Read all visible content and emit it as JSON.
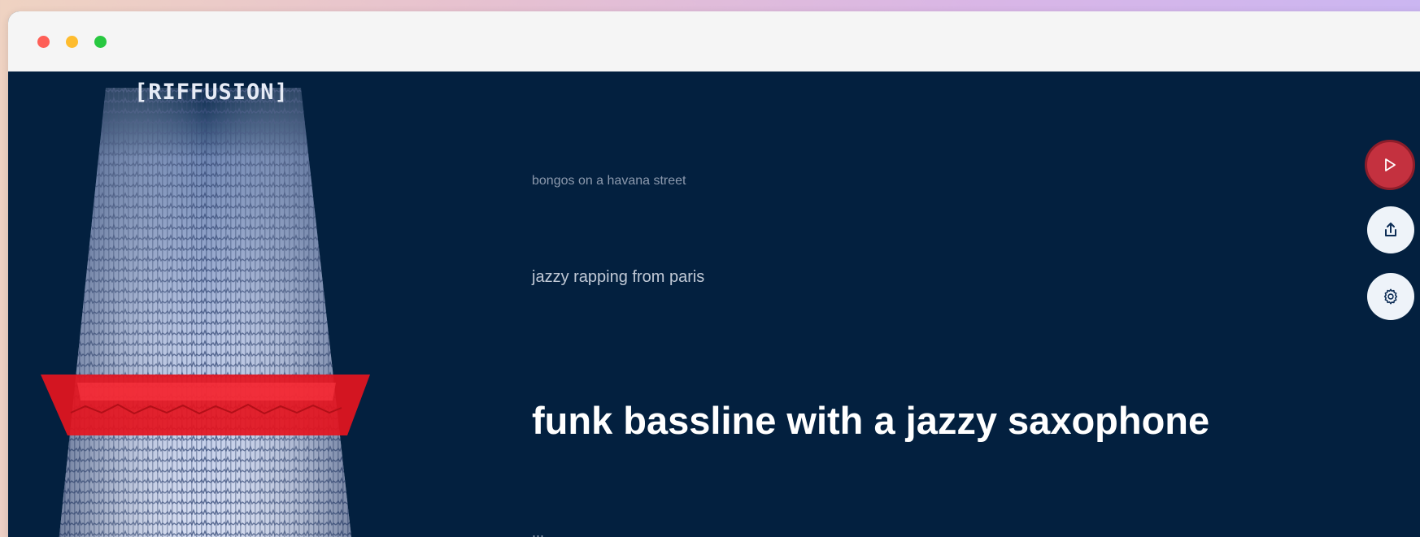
{
  "app": {
    "brand": "[RIFFUSION]"
  },
  "window_controls": [
    "close",
    "minimize",
    "zoom"
  ],
  "prompts": [
    {
      "text": "bongos on a havana street",
      "state": "past"
    },
    {
      "text": "jazzy rapping from paris",
      "state": "previous"
    },
    {
      "text": "funk bassline with a jazzy saxophone",
      "state": "current"
    },
    {
      "text": "...",
      "state": "upcoming"
    }
  ],
  "controls": {
    "play": {
      "icon": "play-icon"
    },
    "share": {
      "icon": "share-icon"
    },
    "settings": {
      "icon": "gear-icon"
    }
  },
  "colors": {
    "background": "#03203f",
    "play_button": "#c4313f",
    "highlight_band": "#e3141f",
    "icon_buttons": "#eef3f9"
  }
}
